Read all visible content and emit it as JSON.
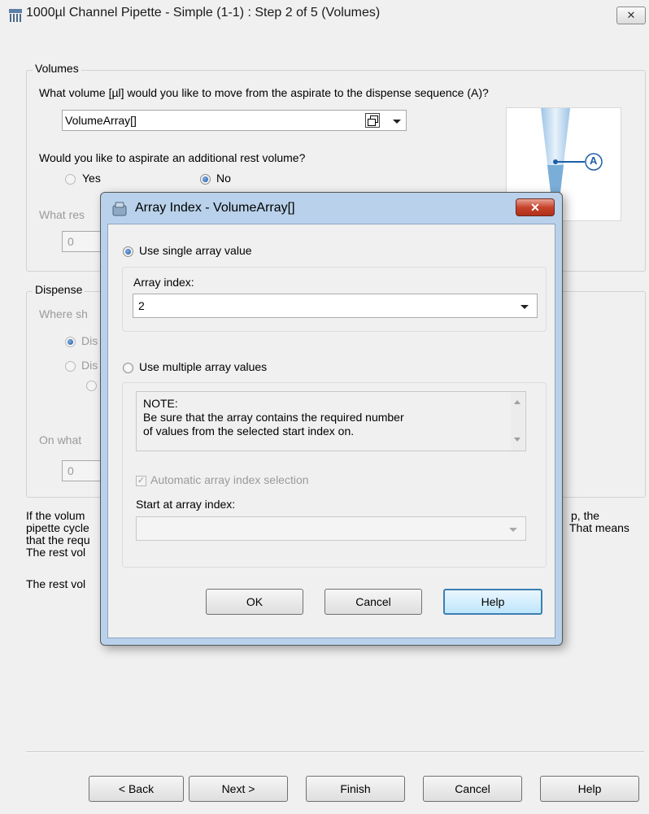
{
  "window": {
    "title": "1000µl Channel Pipette - Simple (1-1) : Step 2 of 5 (Volumes)",
    "close_label": "✕"
  },
  "volumes": {
    "legend": "Volumes",
    "question": "What volume [µl] would you like to move from the aspirate to the dispense sequence (A)?",
    "value": "VolumeArray[]",
    "rest_question": "Would you like to aspirate an additional rest volume?",
    "yes_label": "Yes",
    "no_label": "No",
    "rest_amount_partial": "What res",
    "rest_amount_value": "0"
  },
  "diagram": {
    "marker": "A"
  },
  "dispense": {
    "legend": "Dispense",
    "where_partial": "Where sh",
    "option1_partial": "Dis",
    "option2_partial": "Dis",
    "on_what_partial": "On what",
    "value": "0"
  },
  "info_text": {
    "line1_left": "If the volum",
    "line1_right": "p, the",
    "line2_left": "pipette cycle",
    "line2_right": "That means",
    "line3_left": "that the requ",
    "line4_left": "The rest vol",
    "line5_left": "The rest vol"
  },
  "dialog": {
    "title": "Array Index - VolumeArray[]",
    "close_label": "✕",
    "single_label": "Use single array value",
    "array_index_label": "Array index:",
    "array_index_value": "2",
    "multiple_label": "Use multiple array values",
    "note_line1": "NOTE:",
    "note_line2": "Be sure that the array contains the required number",
    "note_line3": "of values from the selected start index on.",
    "auto_label": "Automatic array index selection",
    "start_label": "Start at array index:",
    "start_value": "",
    "ok_label": "OK",
    "cancel_label": "Cancel",
    "help_label": "Help"
  },
  "footer": {
    "back_label": "< Back",
    "next_label": "Next >",
    "finish_label": "Finish",
    "cancel_label": "Cancel",
    "help_label": "Help"
  }
}
